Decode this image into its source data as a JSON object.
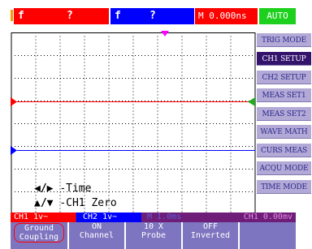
{
  "status_bar": {
    "ch1_letter": "f",
    "ch1_trigger_type": "?",
    "ch2_letter": "f",
    "ch2_trigger_type": "?",
    "timebase": "M 0.000ns",
    "trigger_mode": "AUTO"
  },
  "colors": {
    "ch1": "#ff0000",
    "ch2": "#0000ff",
    "trigger_ok": "#1dd01d",
    "menu_bg": "#b3a9d6",
    "menu_active": "#34136d",
    "info_bar": "#6e1e79",
    "softkey_bg": "#7d75c0",
    "trigger_marker": "#ff00ff",
    "trigger_level": "#22aa22"
  },
  "menu": {
    "items": [
      "TRIG MODE",
      "CH1 SETUP",
      "CH2 SETUP",
      "MEAS SET1",
      "MEAS SET2",
      "WAVE MATH",
      "CURS MEAS",
      "ACQU MODE",
      "TIME MODE"
    ],
    "active_index": 1
  },
  "help": {
    "line1_keys": "◀/▶",
    "line1_text": "-Time",
    "line2_keys": "▲/▼",
    "line2_text": "-CH1 Zero"
  },
  "info_bar": {
    "ch1_scale": "CH1  1v~",
    "ch2_scale": "CH2  1v~",
    "time_div": "M 1.0ms",
    "trigger_level": "CH1 0.00mv"
  },
  "softkeys": [
    {
      "top": "Ground",
      "bottom": "Coupling"
    },
    {
      "top": "ON",
      "bottom": "Channel"
    },
    {
      "top": "10 X",
      "bottom": "Probe"
    },
    {
      "top": "OFF",
      "bottom": "Inverted"
    },
    {
      "top": "",
      "bottom": ""
    }
  ]
}
